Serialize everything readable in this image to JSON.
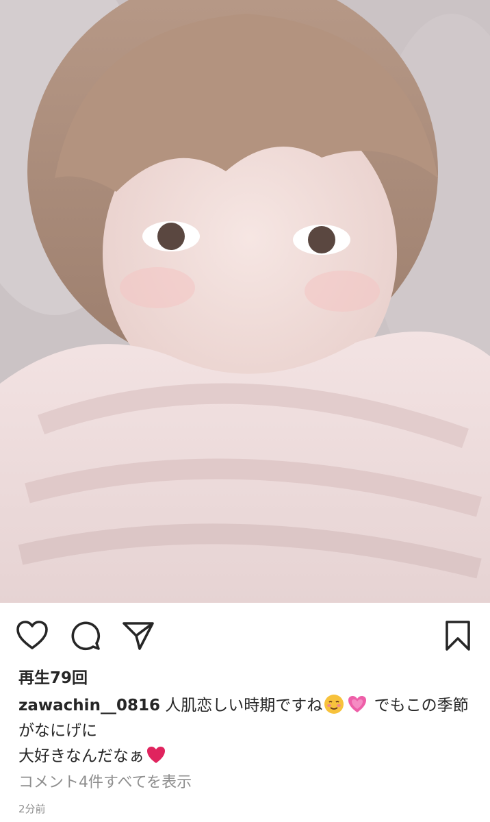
{
  "post": {
    "image_alt": "selfie photo",
    "views_label": "再生79回",
    "username": "zawachin__0816",
    "caption_part1": "人肌恋しい時期ですね",
    "caption_part2": "でもこの季節がなにげに",
    "caption_part3": "大好きなんだなぁ",
    "caption_emojis": [
      "smiling-face-emoji",
      "growing-heart-emoji",
      "red-heart-emoji"
    ],
    "view_comments_label": "コメント4件すべてを表示",
    "time_ago": "2分前"
  },
  "actions": {
    "icons": [
      "heart-icon",
      "comment-icon",
      "share-icon",
      "bookmark-icon"
    ]
  },
  "colors": {
    "text": "#262626",
    "muted": "#8e8e8e",
    "heart": "#e0245e"
  }
}
